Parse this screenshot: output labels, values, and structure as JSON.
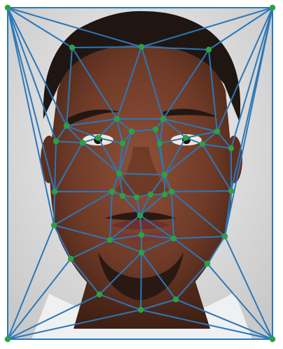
{
  "figure": {
    "image_subject": "portrait-face-photo",
    "colors": {
      "mesh_edges": "#2a78b8",
      "landmarks": "#2ea043",
      "frame": "#1f77b4",
      "backdrop": "#e6e6e6",
      "shirt": "#eef0f2",
      "skin_base": "#7a4330",
      "skin_dark": "#4d2617",
      "hair": "#1f1612",
      "beard": "#2a1912",
      "lips": "#6f2f2a"
    }
  }
}
